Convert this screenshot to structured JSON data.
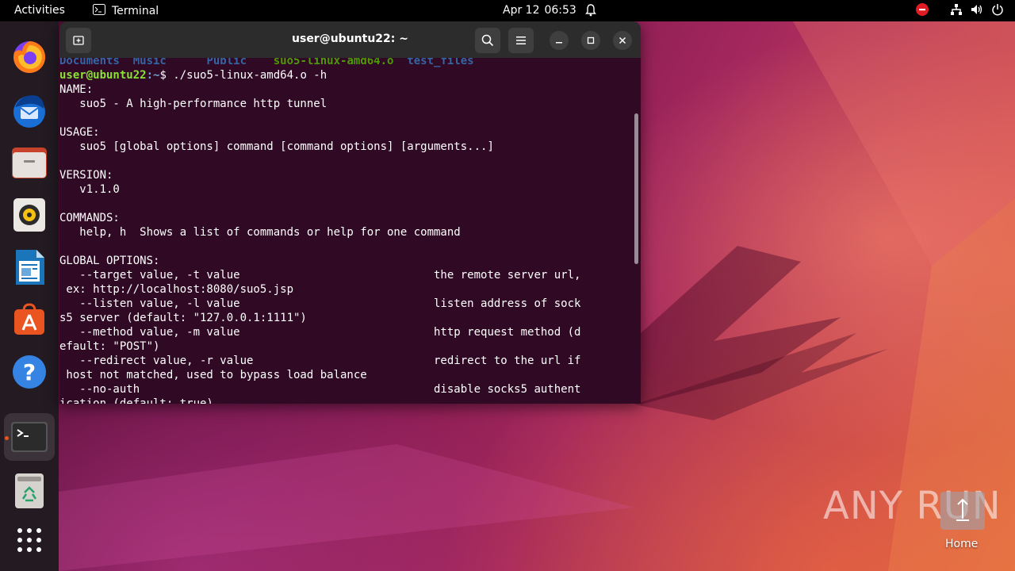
{
  "topbar": {
    "activities": "Activities",
    "app_name": "Terminal",
    "date": "Apr 12",
    "time": "06:53"
  },
  "dock": {
    "items": [
      "firefox-icon",
      "thunderbird-icon",
      "files-icon",
      "rhythmbox-icon",
      "libreoffice-writer-icon",
      "app-center-icon",
      "help-icon",
      "terminal-icon",
      "trash-icon",
      "show-apps-icon"
    ]
  },
  "terminal": {
    "title": "user@ubuntu22: ~",
    "ls_line": {
      "documents": "Documents",
      "music": "Music",
      "public": "Public",
      "executable": "suo5-linux-amd64.o",
      "test_files": "test_files"
    },
    "prompt_user": "user@ubuntu22",
    "prompt_path": ":~",
    "prompt_symbol": "$ ",
    "command": "./suo5-linux-amd64.o -h",
    "output": [
      "NAME:",
      "   suo5 - A high-performance http tunnel",
      "",
      "USAGE:",
      "   suo5 [global options] command [command options] [arguments...]",
      "",
      "VERSION:",
      "   v1.1.0",
      "",
      "COMMANDS:",
      "   help, h  Shows a list of commands or help for one command",
      "",
      "GLOBAL OPTIONS:",
      "   --target value, -t value                             the remote server url,",
      " ex: http://localhost:8080/suo5.jsp",
      "   --listen value, -l value                             listen address of sock",
      "s5 server (default: \"127.0.0.1:1111\")",
      "   --method value, -m value                             http request method (d",
      "efault: \"POST\")",
      "   --redirect value, -r value                           redirect to the url if",
      " host not matched, used to bypass load balance",
      "   --no-auth                                            disable socks5 authent",
      "ication (default: true)"
    ]
  },
  "watermark": {
    "text": "ANY RUN"
  },
  "desktop": {
    "home_label": "Home"
  }
}
